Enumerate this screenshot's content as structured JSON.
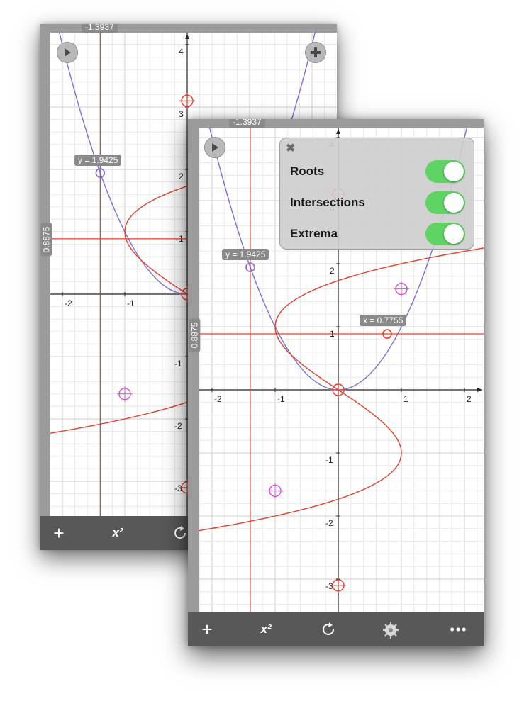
{
  "graph": {
    "x_ticks": [
      "-2",
      "-1",
      "1",
      "2"
    ],
    "y_ticks": [
      "4",
      "3",
      "2",
      "1",
      "-1",
      "-2",
      "-3"
    ],
    "functions": [
      {
        "name": "blue-curve",
        "expression_shown": false,
        "color": "#7a72d8"
      },
      {
        "name": "red-curve",
        "expression_shown": false,
        "color": "#e0402e"
      }
    ],
    "tracer": {
      "x_readout": "-1.3937",
      "y_readout": "0.8875",
      "point_label": "y = 1.9425",
      "intersection_label": "x = 0.7755",
      "color": "#e0402e"
    },
    "markers": {
      "root_color": "#e0402e",
      "extrema_color": "#d94fd4",
      "point_color": "#7a72d8"
    }
  },
  "settings_panel": {
    "close_label": "✖",
    "rows": [
      {
        "label": "Roots",
        "on": true
      },
      {
        "label": "Intersections",
        "on": true
      },
      {
        "label": "Extrema",
        "on": true
      }
    ],
    "toggle_color": "#5fd364"
  },
  "toolbar": {
    "add_label": "+",
    "function_icon": "x-squared-pencil-icon",
    "function_label": "x²",
    "reset_icon": "refresh-icon",
    "settings_icon": "gear-icon",
    "more_label": "•••"
  },
  "buttons": {
    "play_icon": "play-icon",
    "plus_icon": "plus-circle-icon"
  }
}
